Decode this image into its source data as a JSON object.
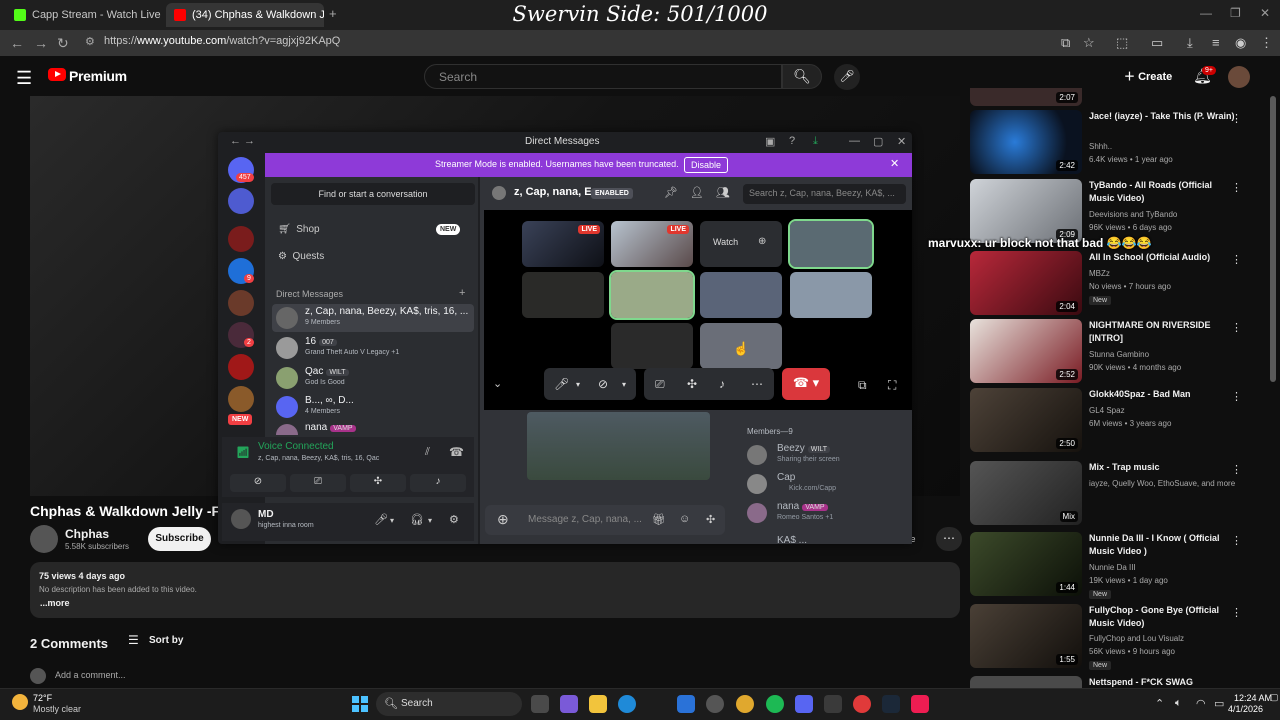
{
  "browser": {
    "tabs": [
      {
        "label": "Capp Stream - Watch Live on K",
        "active": false
      },
      {
        "label": "(34) Chphas & Walkdown Jelly",
        "active": true
      }
    ],
    "url_prefix": "https://",
    "url_host": "www.youtube.com",
    "url_path": "/watch?v=agjxj92KApQ"
  },
  "overlay_title": "Swervin Side: 501/1000",
  "youtube": {
    "brand": "Premium",
    "search_placeholder": "Search",
    "create_label": "Create",
    "notif_count": "9+",
    "video_title": "Chphas & Walkdown Jelly -FIRS",
    "channel": {
      "name": "Chphas",
      "subscribers": "5.58K subscribers",
      "subscribe_label": "Subscribe"
    },
    "save_fragment": "ve",
    "description": {
      "meta": "75 views  4 days ago",
      "text": "No description has been added to this video.",
      "more": "...more"
    },
    "comments": {
      "count": "2 Comments",
      "sort_label": "Sort by",
      "add_placeholder": "Add a comment..."
    },
    "chat_overlay": "marvuxx: ur block not that bad 😂😂😂",
    "recommendations": [
      {
        "title": "Jace! (iayze) - Take This (P. Wrain)",
        "channel": "Shhh..",
        "stats": "6.4K views • 1 year ago",
        "duration": "2:42",
        "badge": ""
      },
      {
        "title": "TyBando - All Roads (Official Music Video)",
        "channel": "Deevisions and TyBando",
        "stats": "96K views • 6 days ago",
        "duration": "2:09",
        "badge": ""
      },
      {
        "title": "All In School (Official Audio)",
        "channel": "MBZz",
        "stats": "No views • 7 hours ago",
        "duration": "2:04",
        "badge": "New"
      },
      {
        "title": "NIGHTMARE ON RIVERSIDE [INTRO]",
        "channel": "Stunna Gambino",
        "stats": "90K views • 4 months ago",
        "duration": "2:52",
        "badge": ""
      },
      {
        "title": "Glokk40Spaz - Bad Man",
        "channel": "GL4 Spaz",
        "stats": "6M views • 3 years ago",
        "duration": "2:50",
        "badge": ""
      },
      {
        "title": "Mix - Trap music",
        "channel": "iayze, Quelly Woo, EthoSuave, and more",
        "stats": "",
        "duration": "Mix",
        "badge": ""
      },
      {
        "title": "Nunnie Da III - I Know ( Official Music Video )",
        "channel": "Nunnie Da III",
        "stats": "19K views • 1 day ago",
        "duration": "1:44",
        "badge": "New"
      },
      {
        "title": "FullyChop - Gone Bye (Official Music Video)",
        "channel": "FullyChop and Lou Visualz",
        "stats": "56K views • 9 hours ago",
        "duration": "1:55",
        "badge": "New"
      },
      {
        "title": "Nettspend - F*CK SWAG",
        "channel": "",
        "stats": "",
        "duration": "",
        "badge": ""
      }
    ],
    "top_partial_duration": "2:07"
  },
  "discord": {
    "window_title": "Direct Messages",
    "streamer_banner": "Streamer Mode is enabled. Usernames have been truncated.",
    "disable_label": "Disable",
    "server_badges": [
      "457",
      "9",
      "2"
    ],
    "new_label": "NEW",
    "find_placeholder": "Find or start a conversation",
    "nav": [
      {
        "label": "Shop",
        "badge": "NEW"
      },
      {
        "label": "Quests",
        "badge": ""
      }
    ],
    "dm_header": "Direct Messages",
    "dms": [
      {
        "name": "z, Cap, nana, Beezy, KA$, tris, 16, ...",
        "sub": "9 Members",
        "tag": ""
      },
      {
        "name": "16",
        "sub": "Grand Theft Auto V Legacy +1",
        "tag": "007"
      },
      {
        "name": "Qac",
        "sub": "God Is Good",
        "tag": "WILT"
      },
      {
        "name": "B..., ∞, D...",
        "sub": "4 Members",
        "tag": ""
      },
      {
        "name": "nana",
        "sub": "",
        "tag": "VAMP"
      }
    ],
    "voice": {
      "title": "Voice Connected",
      "members": "z, Cap, nana, Beezy, KA$, tris, 16, Qac"
    },
    "user": {
      "name": "MD",
      "status": "highest inna room"
    },
    "header": {
      "name": "z, Cap, nana, E",
      "enabled": "ENABLED",
      "search": "Search z, Cap, nana, Beezy, KA$, ..."
    },
    "live_label": "LIVE",
    "watch_label": "Watch",
    "members_header": "Members—9",
    "members": [
      {
        "name": "Beezy",
        "tag": "WILT",
        "sub": "Sharing their screen"
      },
      {
        "name": "Cap",
        "tag": "",
        "sub": "Kick.com/Capp"
      },
      {
        "name": "nana",
        "tag": "VAMP",
        "sub": "Romeo Santos +1"
      },
      {
        "name": "KA$ ...",
        "tag": "",
        "sub": ""
      }
    ],
    "message_placeholder": "Message z, Cap, nana, ..."
  },
  "taskbar": {
    "temp": "72°F",
    "condition": "Mostly clear",
    "search_label": "Search",
    "time": "12:24 AM",
    "date": "4/1/2026"
  }
}
